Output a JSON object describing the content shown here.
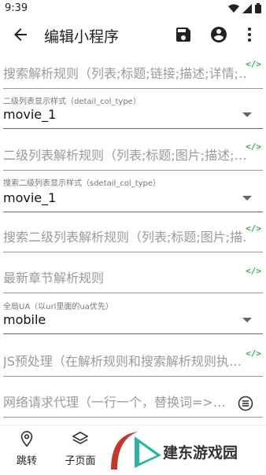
{
  "status": {
    "time": "9:39"
  },
  "appbar": {
    "title": "编辑小程序"
  },
  "fields": {
    "search_rule": "搜索解析规则（列表;标题;链接;描述;详情;…",
    "detail_col_label": "二级列表显示样式（detail_col_type）",
    "detail_col_value": "movie_1",
    "second_rule": "二级列表解析规则（列表;标题;图片;描述;…",
    "sdetail_col_label": "搜索二级列表显示样式（sdetail_col_type）",
    "sdetail_col_value": "movie_1",
    "search_second_rule": "搜索二级列表解析规则（列表;标题;图片;描…",
    "latest_chapter": "最新章节解析规则",
    "ua_label": "全局UA（以url里面的ua优先）",
    "ua_value": "mobile",
    "js_preprocess": "JS预处理（在解析规则和搜索解析规则执…",
    "proxy": "网络请求代理（一行一个，替换词=>…"
  },
  "code_toggle": "</>",
  "nav": {
    "jump": "跳转",
    "subpage": "子页面"
  },
  "watermark": {
    "text": "建东游戏园"
  },
  "colors": {
    "code_green": "#2bb24c",
    "accent": "#c0392b"
  }
}
